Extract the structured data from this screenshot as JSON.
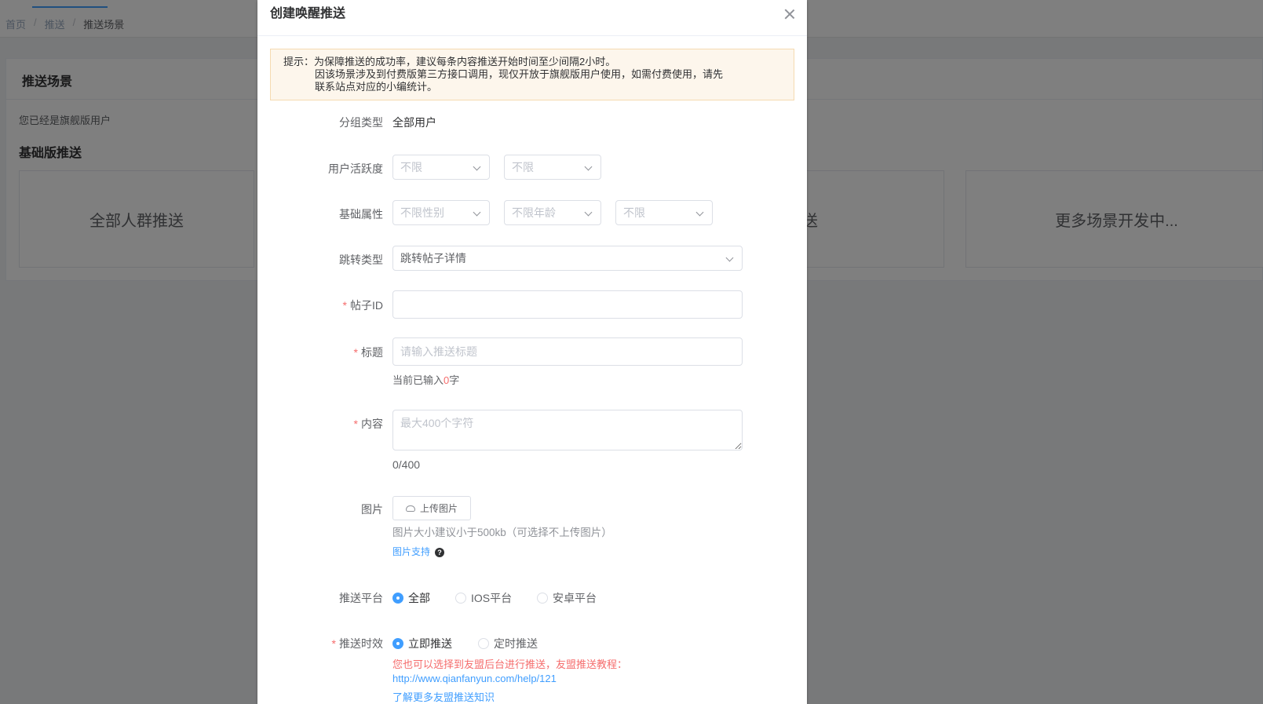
{
  "breadcrumb": {
    "home": "首页",
    "push": "推送",
    "current": "推送场景",
    "sep": "/"
  },
  "panel": {
    "title": "推送场景",
    "note": "您已经是旗舰版用户",
    "subtitle": "基础版推送",
    "cards": [
      "全部人群推送",
      "送",
      "更多场景开发中..."
    ]
  },
  "dialog": {
    "title": "创建唤醒推送",
    "tip": {
      "line1": "提示：为保障推送的成功率，建议每条内容推送开始时间至少间隔2小时。",
      "line2": "因该场景涉及到付费版第三方接口调用，现仅开放于旗舰版用户使用，如需付费使用，请先",
      "line3": "联系站点对应的小编统计。"
    },
    "group_type": {
      "label": "分组类型",
      "value": "全部用户"
    },
    "activity": {
      "label": "用户活跃度",
      "select1": "不限",
      "select2": "不限"
    },
    "basic_attr": {
      "label": "基础属性",
      "gender": "不限性别",
      "age": "不限年龄",
      "other": "不限"
    },
    "jump_type": {
      "label": "跳转类型",
      "value": "跳转帖子详情"
    },
    "post_id": {
      "required": "*",
      "label": "帖子ID",
      "value": ""
    },
    "title_field": {
      "required": "*",
      "label": "标题",
      "placeholder": "请输入推送标题",
      "count_prefix": "当前已输入",
      "count": "0",
      "count_suffix": "字"
    },
    "content": {
      "required": "*",
      "label": "内容",
      "placeholder": "最大400个字符",
      "counter": "0/400"
    },
    "image": {
      "label": "图片",
      "upload_label": "上传图片",
      "hint": "图片大小建议小于500kb（可选择不上传图片）",
      "support_link": "图片支持",
      "help": "?"
    },
    "platform": {
      "label": "推送平台",
      "options": [
        "全部",
        "IOS平台",
        "安卓平台"
      ],
      "selected": "全部"
    },
    "timing": {
      "required": "*",
      "label": "推送时效",
      "options": [
        "立即推送",
        "定时推送"
      ],
      "selected": "立即推送",
      "notice": "您也可以选择到友盟后台进行推送，友盟推送教程：",
      "url": "http://www.qianfanyun.com/help/121",
      "learn_more": "了解更多友盟推送知识"
    }
  },
  "colors": {
    "primary": "#409eff",
    "danger": "#f56c6c",
    "warning_bg": "#fdf6ec"
  }
}
